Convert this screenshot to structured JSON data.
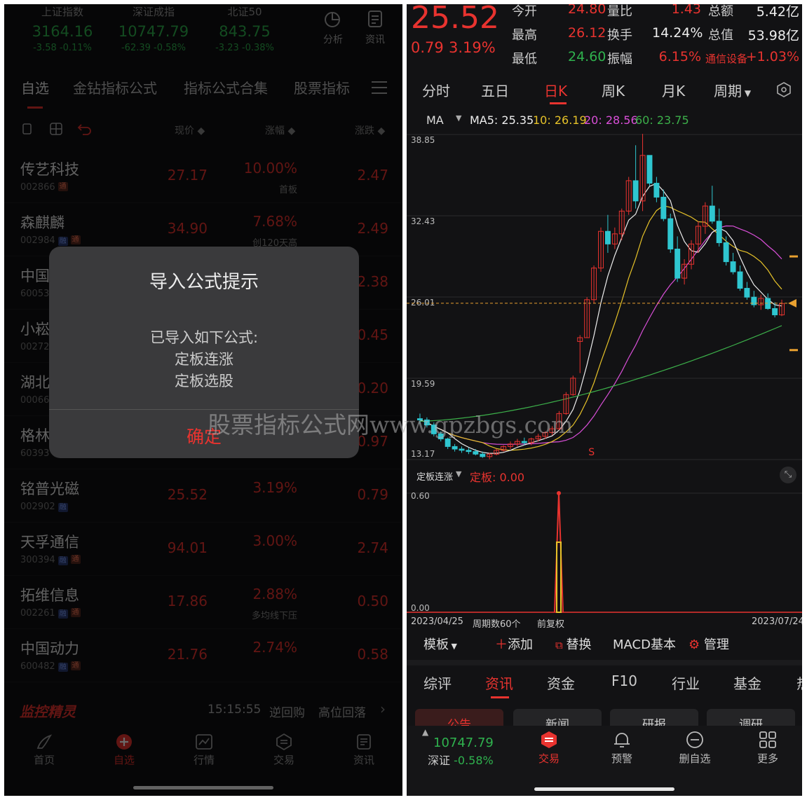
{
  "left": {
    "indices": [
      {
        "name": "上证指数",
        "value": "3164.16",
        "chg": "-3.58  -0.11%"
      },
      {
        "name": "深证成指",
        "value": "10747.79",
        "chg": "-62.39  -0.58%"
      },
      {
        "name": "北证50",
        "value": "843.75",
        "chg": "-3.23  -0.38%"
      }
    ],
    "top_icons": [
      {
        "label": "分析"
      },
      {
        "label": "资讯"
      }
    ],
    "tabs": [
      "自选",
      "金钻指标公式",
      "指标公式合集",
      "股票指标"
    ],
    "columns": {
      "price": "现价 ◆",
      "pct": "涨幅 ◆",
      "chg": "涨跌 ◆"
    },
    "stocks": [
      {
        "name": "传艺科技",
        "code": "002866",
        "tags": [
          "通"
        ],
        "price": "27.17",
        "pct": "10.00%",
        "note": "首板",
        "chg": "2.47"
      },
      {
        "name": "森麒麟",
        "code": "002984",
        "tags": [
          "融",
          "通"
        ],
        "price": "34.90",
        "pct": "7.68%",
        "note": "创120天高",
        "chg": "2.49"
      },
      {
        "name": "中国",
        "code": "60053",
        "tags": [],
        "price": "",
        "pct": "",
        "note": "",
        "chg": "2.38"
      },
      {
        "name": "小崧",
        "code": "00272",
        "tags": [],
        "price": "",
        "pct": "",
        "note": "",
        "chg": "0.45"
      },
      {
        "name": "湖北",
        "code": "00066",
        "tags": [],
        "price": "",
        "pct": "",
        "note": "",
        "chg": "0.20"
      },
      {
        "name": "格林",
        "code": "60393",
        "tags": [],
        "price": "",
        "pct": "",
        "note": "",
        "chg": "0.97"
      },
      {
        "name": "铭普光磁",
        "code": "002902",
        "tags": [
          "融"
        ],
        "price": "25.52",
        "pct": "3.19%",
        "note": "",
        "chg": "0.79"
      },
      {
        "name": "天孚通信",
        "code": "300394",
        "tags": [
          "融",
          "通"
        ],
        "price": "94.01",
        "pct": "3.00%",
        "note": "",
        "chg": "2.74"
      },
      {
        "name": "拓维信息",
        "code": "002261",
        "tags": [
          "融",
          "通"
        ],
        "price": "17.86",
        "pct": "2.88%",
        "note": "多均线下压",
        "chg": "0.50"
      },
      {
        "name": "中国动力",
        "code": "600482",
        "tags": [
          "融",
          "通"
        ],
        "price": "21.76",
        "pct": "2.74%",
        "note": "",
        "chg": "0.58"
      }
    ],
    "monitor": {
      "brand": "监控精灵",
      "time": "15:15:55",
      "event1": "逆回购",
      "event2": "高位回落"
    },
    "nav": [
      "首页",
      "自选",
      "行情",
      "交易",
      "资讯"
    ],
    "dialog": {
      "title": "导入公式提示",
      "line1": "已导入如下公式:",
      "line2": "定板连涨",
      "line3": "定板选股",
      "confirm": "确定"
    }
  },
  "right": {
    "quote": {
      "price": "25.52",
      "chg": "0.79",
      "pct": "3.19%",
      "fields": [
        {
          "l": "今开",
          "v": "24.80",
          "l2": "量比",
          "v2": "1.43",
          "l3": "总额",
          "v3": "5.42亿"
        },
        {
          "l": "最高",
          "v": "26.12",
          "l2": "换手",
          "v2": "14.24%",
          "l3": "总值",
          "v3": "53.98亿"
        },
        {
          "l": "最低",
          "v": "24.60",
          "l2": "振幅",
          "v2": "6.15%",
          "l3": "通信设备",
          "v3": "+1.03%"
        }
      ]
    },
    "tabs": [
      "分时",
      "五日",
      "日K",
      "周K",
      "月K",
      "周期"
    ],
    "ma": {
      "label": "MA",
      "ma5": "MA5: 25.35",
      "ma10": "10: 26.19",
      "ma20": "20: 28.56",
      "ma60": "60: 23.75"
    },
    "yaxis": [
      "38.85",
      "32.43",
      "26.01",
      "19.59",
      "13.17"
    ],
    "sub": {
      "name": "定板连涨",
      "value": "定板: 0.00",
      "top": "0.60",
      "bottom": "0.00"
    },
    "footer": {
      "start": "2023/04/25",
      "period": "周期数60个",
      "adj": "前复权",
      "end": "2023/07/24"
    },
    "tools": [
      "模板",
      "添加",
      "替换",
      "MACD基本",
      "管理"
    ],
    "btabs": [
      "综评",
      "资讯",
      "资金",
      "F10",
      "行业",
      "基金"
    ],
    "subtabs": [
      "公告",
      "新闻",
      "研报",
      "调研"
    ],
    "bottom": {
      "idx_value": "10747.79",
      "idx_name": "深证",
      "idx_pct": "-0.58%"
    },
    "nav": [
      "交易",
      "预警",
      "删自选",
      "更多"
    ],
    "watermark": "股票指标公式网www.gpzbgs.com",
    "chart_data": {
      "type": "candlestick",
      "ylim": [
        13.17,
        38.85
      ],
      "candles": [
        [
          16.4,
          16.8,
          16.0,
          16.3
        ],
        [
          16.3,
          16.5,
          15.7,
          15.9
        ],
        [
          15.9,
          16.1,
          15.0,
          15.2
        ],
        [
          15.2,
          15.4,
          14.6,
          14.8
        ],
        [
          14.8,
          14.9,
          14.0,
          14.2
        ],
        [
          14.2,
          14.4,
          13.8,
          14.0
        ],
        [
          14.0,
          14.2,
          13.7,
          13.9
        ],
        [
          13.9,
          14.1,
          13.6,
          13.8
        ],
        [
          13.8,
          14.0,
          13.5,
          13.6
        ],
        [
          13.6,
          13.8,
          13.3,
          13.4
        ],
        [
          13.4,
          13.7,
          13.2,
          13.6
        ],
        [
          13.6,
          14.0,
          13.5,
          13.9
        ],
        [
          13.9,
          14.3,
          13.8,
          14.2
        ],
        [
          14.2,
          14.6,
          14.0,
          14.4
        ],
        [
          14.4,
          14.8,
          14.2,
          14.6
        ],
        [
          14.6,
          14.9,
          14.3,
          14.5
        ],
        [
          14.5,
          14.9,
          14.3,
          14.8
        ],
        [
          14.8,
          15.2,
          14.6,
          15.0
        ],
        [
          15.0,
          15.4,
          14.8,
          15.3
        ],
        [
          15.3,
          15.8,
          15.1,
          15.6
        ],
        [
          15.6,
          17.0,
          15.5,
          16.8
        ],
        [
          16.8,
          18.5,
          16.7,
          18.3
        ],
        [
          18.3,
          19.8,
          18.2,
          19.6
        ],
        [
          22.5,
          23.0,
          20.0,
          22.8
        ],
        [
          22.8,
          26.0,
          22.8,
          25.8
        ],
        [
          25.8,
          28.5,
          25.5,
          28.3
        ],
        [
          28.3,
          31.5,
          28.0,
          31.2
        ],
        [
          31.2,
          32.5,
          29.5,
          30.2
        ],
        [
          30.2,
          31.5,
          29.8,
          31.0
        ],
        [
          31.0,
          33.0,
          30.5,
          32.8
        ],
        [
          32.8,
          35.5,
          32.5,
          35.2
        ],
        [
          35.2,
          38.0,
          33.0,
          33.6
        ],
        [
          33.6,
          38.9,
          32.8,
          37.2
        ],
        [
          37.2,
          36.5,
          34.8,
          35.0
        ],
        [
          35.0,
          35.5,
          33.5,
          33.9
        ],
        [
          33.9,
          34.5,
          32.0,
          32.2
        ],
        [
          32.2,
          32.6,
          29.5,
          29.8
        ],
        [
          29.8,
          30.8,
          27.2,
          27.5
        ],
        [
          27.5,
          29.0,
          27.0,
          28.6
        ],
        [
          28.6,
          30.5,
          28.2,
          30.2
        ],
        [
          30.2,
          32.0,
          29.5,
          31.6
        ],
        [
          31.6,
          33.5,
          31.0,
          33.2
        ],
        [
          33.2,
          34.8,
          31.8,
          32.0
        ],
        [
          32.0,
          33.0,
          30.0,
          30.3
        ],
        [
          30.3,
          30.8,
          28.5,
          28.8
        ],
        [
          28.8,
          29.5,
          27.8,
          28.0
        ],
        [
          28.0,
          28.5,
          26.5,
          26.7
        ],
        [
          26.7,
          27.2,
          25.8,
          26.0
        ],
        [
          26.0,
          26.5,
          25.2,
          25.4
        ],
        [
          25.4,
          26.2,
          25.0,
          25.9
        ],
        [
          25.9,
          26.3,
          25.0,
          25.1
        ],
        [
          25.1,
          25.6,
          24.4,
          24.6
        ],
        [
          24.6,
          25.8,
          24.5,
          25.5
        ]
      ],
      "ma_last": {
        "MA5": 25.35,
        "MA10": 26.19,
        "MA20": 28.56,
        "MA60": 23.75
      }
    }
  },
  "colors": {
    "up": "#e8332f",
    "down": "#2fc6d0",
    "accent": "#e8332f",
    "green": "#2fb24e"
  }
}
